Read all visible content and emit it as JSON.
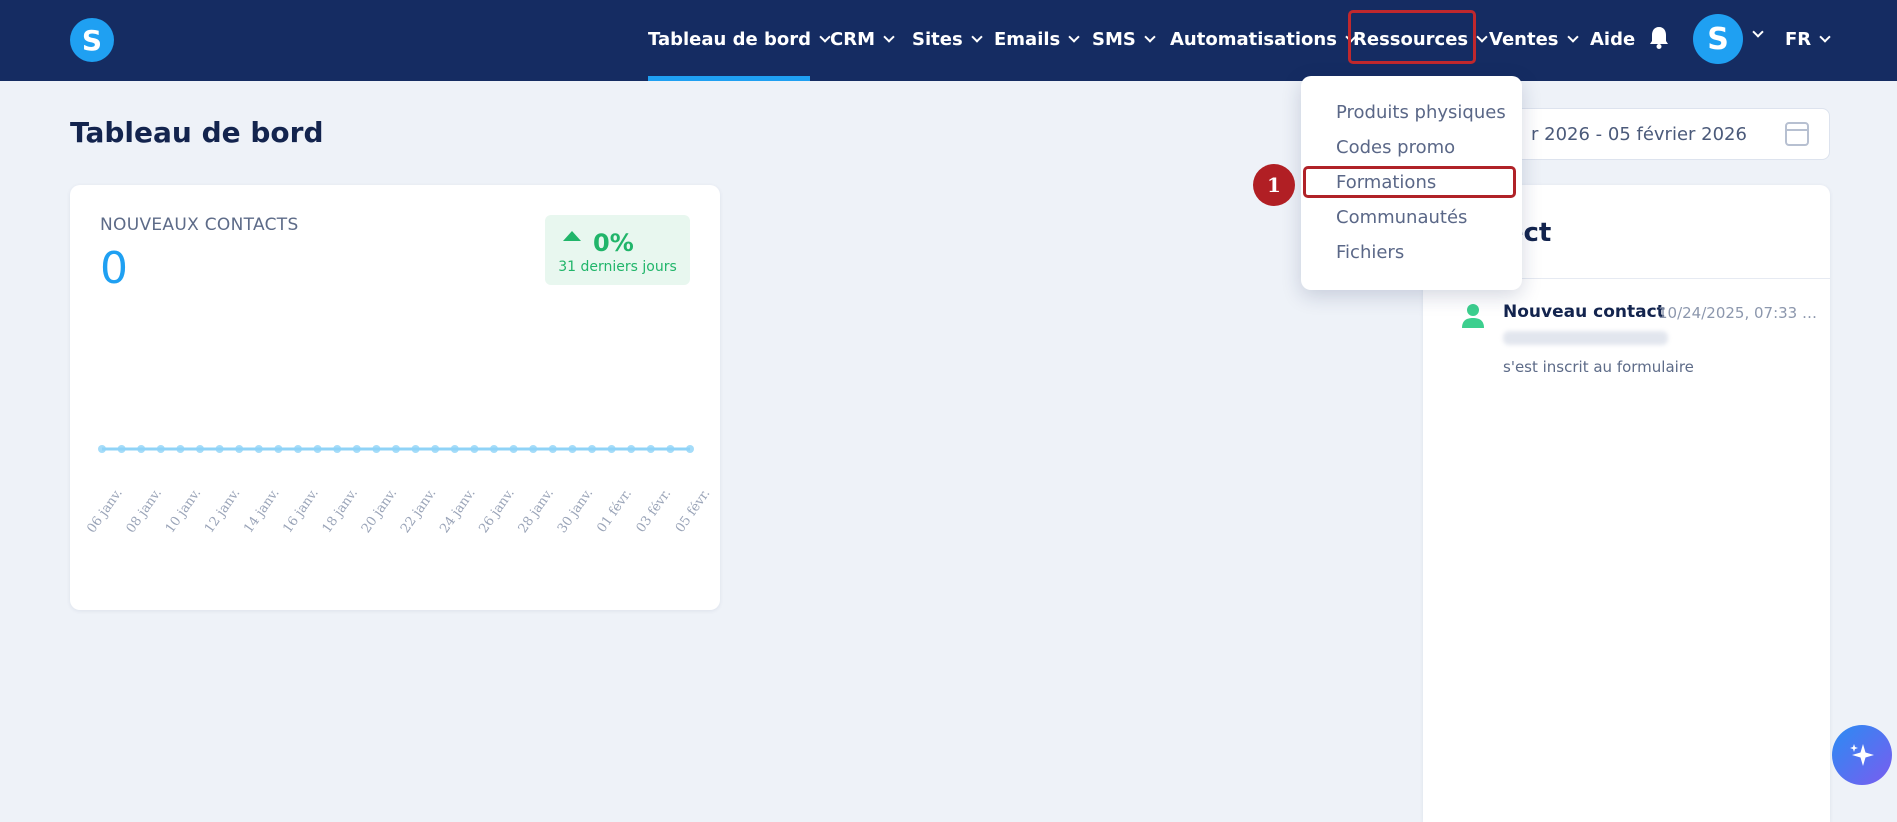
{
  "brand": {
    "logo_letter": "S"
  },
  "nav": {
    "items": [
      {
        "label": "Tableau de bord",
        "has_dropdown": true,
        "active": true
      },
      {
        "label": "CRM",
        "has_dropdown": true
      },
      {
        "label": "Sites",
        "has_dropdown": true
      },
      {
        "label": "Emails",
        "has_dropdown": true
      },
      {
        "label": "SMS",
        "has_dropdown": true
      },
      {
        "label": "Automatisations",
        "has_dropdown": true
      },
      {
        "label": "Ressources",
        "has_dropdown": true,
        "open": true
      },
      {
        "label": "Ventes",
        "has_dropdown": true
      },
      {
        "label": "Aide",
        "has_dropdown": false
      }
    ],
    "notifications_icon": "bell-icon",
    "avatar_letter": "S",
    "language": "FR"
  },
  "page": {
    "title": "Tableau de bord",
    "date_range": "r 2026 - 05 février 2026"
  },
  "contacts_card": {
    "title": "NOUVEAUX CONTACTS",
    "value": "0",
    "trend_pct": "0%",
    "trend_period": "31 derniers jours"
  },
  "chart_data": {
    "type": "line",
    "title": "",
    "x_tick_labels": [
      "06 janv.",
      "08 janv.",
      "10 janv.",
      "12 janv.",
      "14 janv.",
      "16 janv.",
      "18 janv.",
      "20 janv.",
      "22 janv.",
      "24 janv.",
      "26 janv.",
      "28 janv.",
      "30 janv.",
      "01 févr.",
      "03 févr.",
      "05 févr."
    ],
    "series": [
      {
        "values": [
          0,
          0,
          0,
          0,
          0,
          0,
          0,
          0,
          0,
          0,
          0,
          0,
          0,
          0,
          0,
          0,
          0,
          0,
          0,
          0,
          0,
          0,
          0,
          0,
          0,
          0,
          0,
          0,
          0,
          0,
          0
        ]
      }
    ],
    "color": "#8fd3f7"
  },
  "live_panel": {
    "title": "rect",
    "entry": {
      "name": "Nouveau contact",
      "time": "10/24/2025, 07:33 …",
      "action": "s'est inscrit au formulaire"
    }
  },
  "dropdown": {
    "items": [
      "Produits physiques",
      "Codes promo",
      "Formations",
      "Communautés",
      "Fichiers"
    ],
    "highlighted": "Formations"
  },
  "annotation": {
    "step": "1"
  },
  "colors": {
    "nav_bg": "#152c62",
    "accent": "#1fa0f2",
    "highlight": "#b02228",
    "success": "#21b56a"
  }
}
